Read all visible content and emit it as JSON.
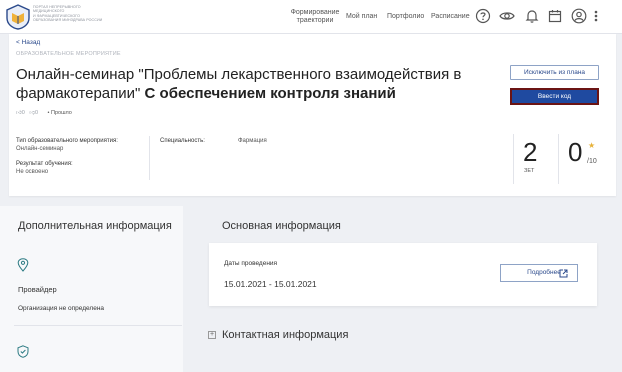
{
  "header": {
    "logo_lines": [
      "ПОРТАЛ НЕПРЕРЫВНОГО",
      "МЕДИЦИНСКОГО",
      "И ФАРМАЦЕВТИЧЕСКОГО",
      "ОБРАЗОВАНИЯ МИНЗДРАВА РОССИИ"
    ],
    "nav_trajectories": "Формирование траектории",
    "nav_plan": "Мой план",
    "nav_portfolio": "Портфолио",
    "nav_schedule": "Расписание",
    "icons": [
      "help-icon",
      "eye-icon",
      "bell-icon",
      "calendar-icon",
      "user-icon",
      "more-vert-icon"
    ]
  },
  "event": {
    "back": "< Назад",
    "category": "ОБРАЗОВАТЕЛЬНОЕ МЕРОПРИЯТИЕ",
    "title_main": "Онлайн-семинар \"Проблемы лекарственного взаимодействия в фармакотерапии\"",
    "title_bold": "С обеспечением контроля знаний",
    "likes": "0",
    "dislikes": "0",
    "status": "Прошло",
    "exclude_button": "Исключить из плана",
    "code_button": "Ввести код",
    "type_label": "Тип образовательного мероприятия:",
    "type_value": "Онлайн-семинар",
    "result_label": "Результат обучения:",
    "result_value": "Не освоено",
    "specialty_label": "Специальность:",
    "specialty_value": "Фармация",
    "zet_value": "2",
    "zet_label": "ЗЕТ",
    "score_value": "0",
    "score_max": "/10"
  },
  "additional": {
    "heading": "Дополнительная информация",
    "provider_label": "Провайдер",
    "provider_value": "Организация не определена"
  },
  "main_info": {
    "heading": "Основная информация",
    "dates_label": "Даты проведения",
    "dates_value": "15.01.2021 - 15.01.2021",
    "more_button": "Подробнее",
    "contact_heading": "Контактная информация"
  },
  "colors": {
    "accent": "#1f4aa0",
    "highlight_border": "#6b1414",
    "star": "#e7b23a"
  }
}
